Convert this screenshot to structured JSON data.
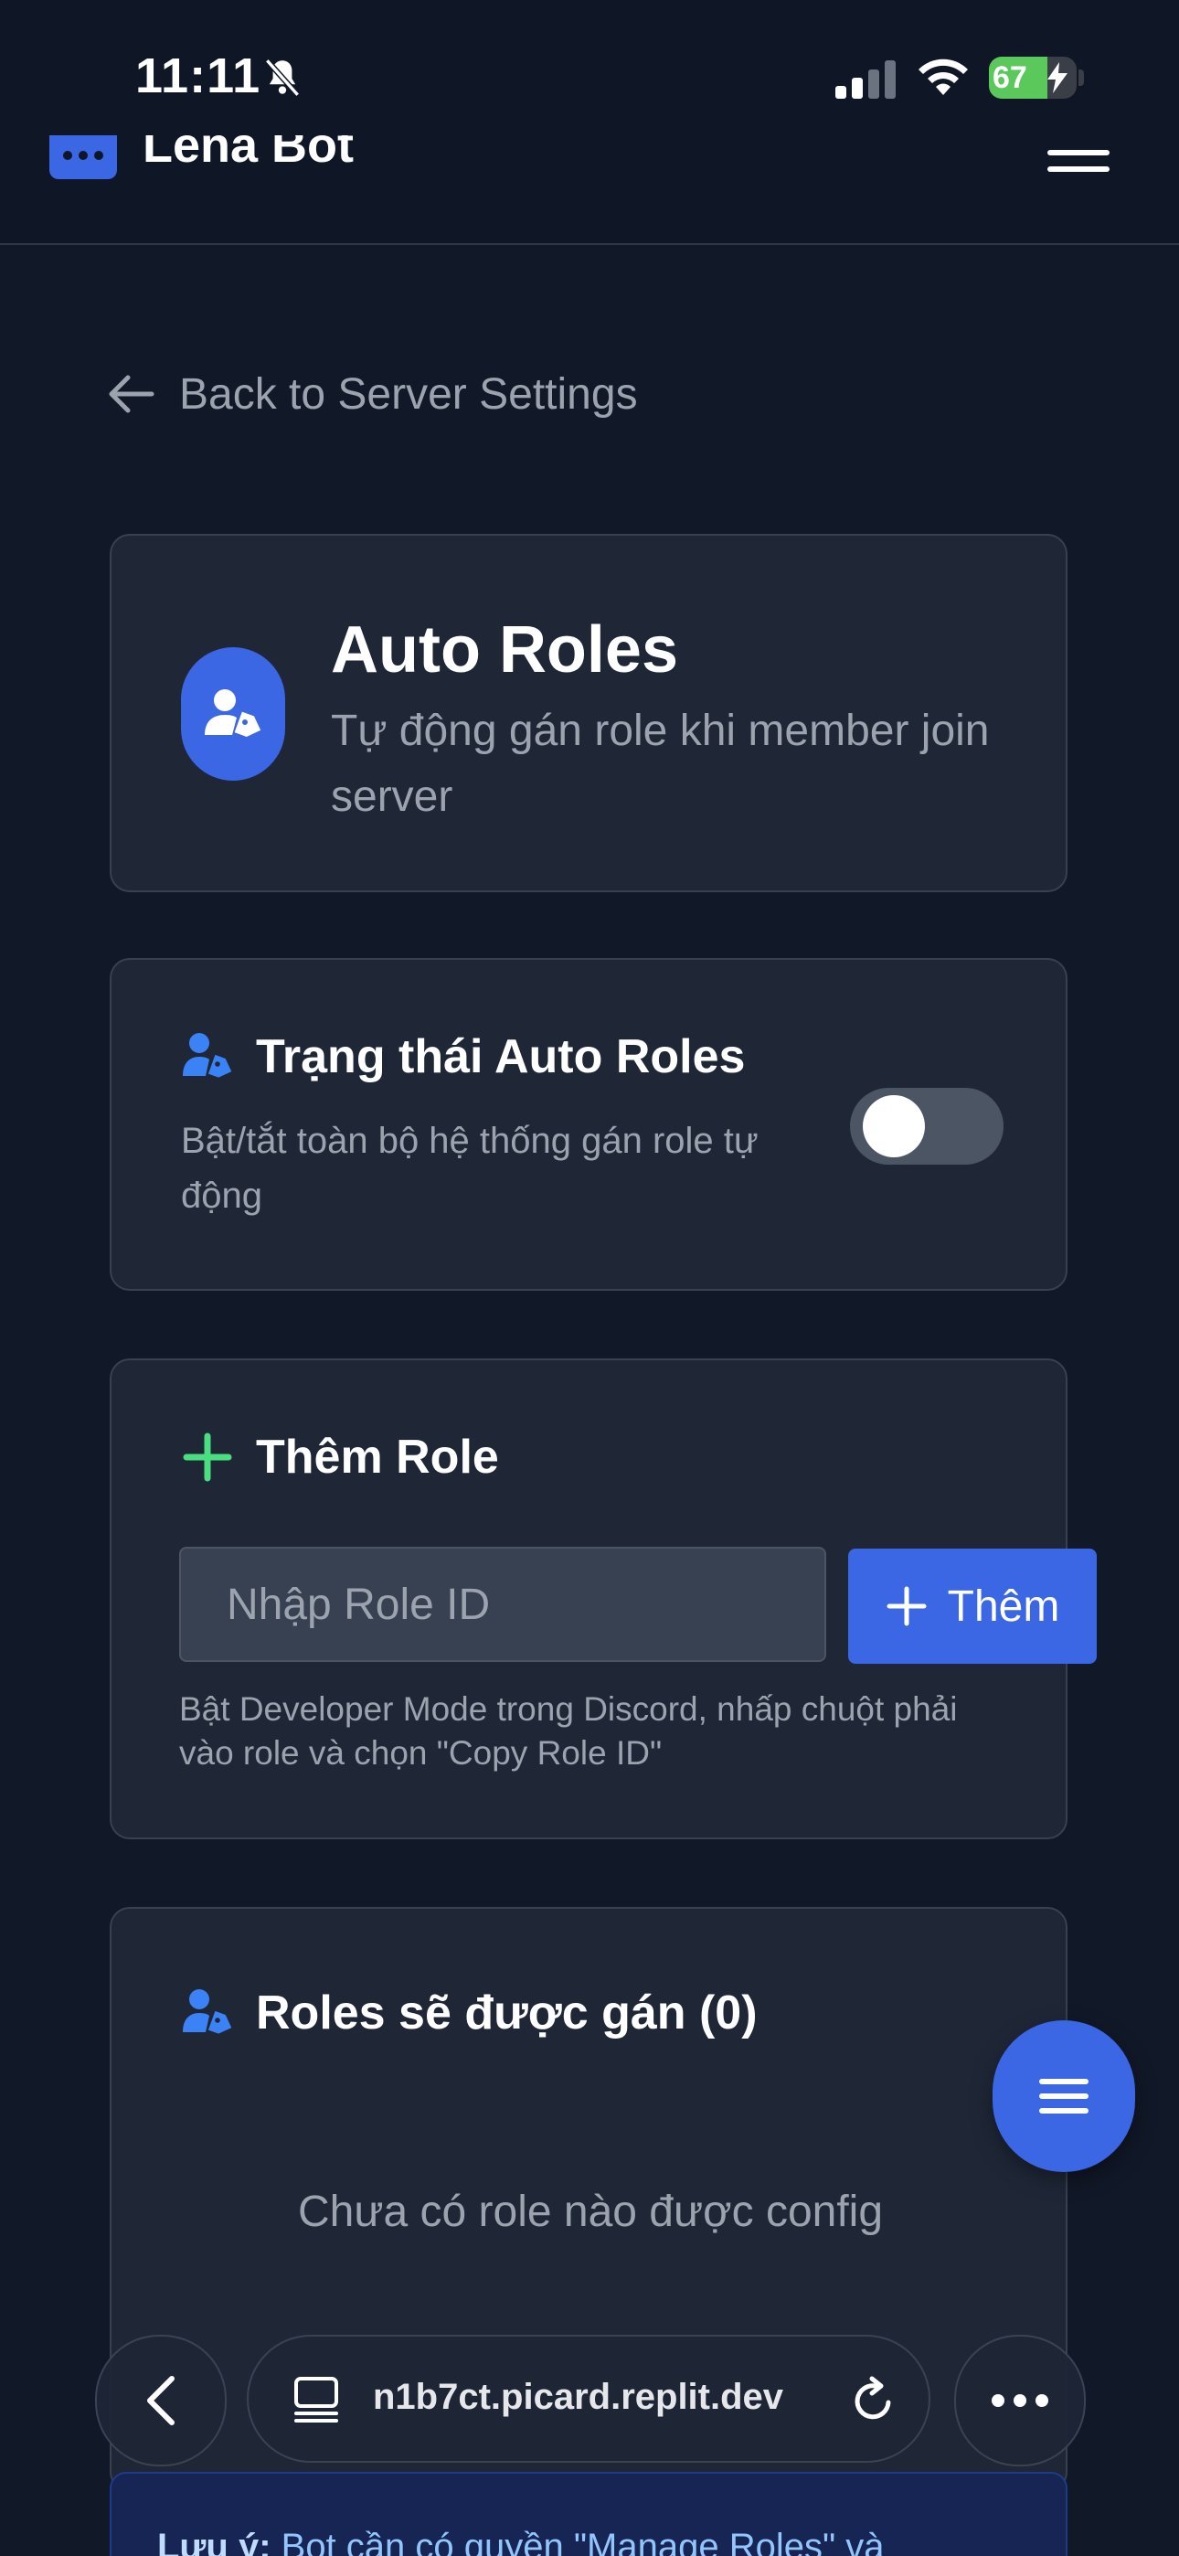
{
  "status_bar": {
    "time": "11:11",
    "battery": "67",
    "battery_level": 0.67
  },
  "nav": {
    "brand": "Lena Bot"
  },
  "back_link": "Back to Server Settings",
  "header": {
    "title": "Auto Roles",
    "subtitle": "Tự động gán role khi member join server"
  },
  "status_card": {
    "title": "Trạng thái Auto Roles",
    "description": "Bật/tắt toàn bộ hệ thống gán role tự động",
    "enabled": false
  },
  "add_card": {
    "title": "Thêm Role",
    "input_placeholder": "Nhập Role ID",
    "button_label": "Thêm",
    "hint": "Bật Developer Mode trong Discord, nhấp chuột phải vào role và chọn \"Copy Role ID\""
  },
  "roles_card": {
    "title": "Roles sẽ được gán (0)",
    "empty_text": "Chưa có role nào được config"
  },
  "note": {
    "label": "Lưu ý:",
    "text": "Bot cần có quyền \"Manage Roles\" và"
  },
  "browser": {
    "url": "n1b7ct.picard.replit.dev"
  },
  "colors": {
    "background": "#111827",
    "card": "#1f2737",
    "accent": "#3b66e4",
    "success": "#4ade80"
  }
}
